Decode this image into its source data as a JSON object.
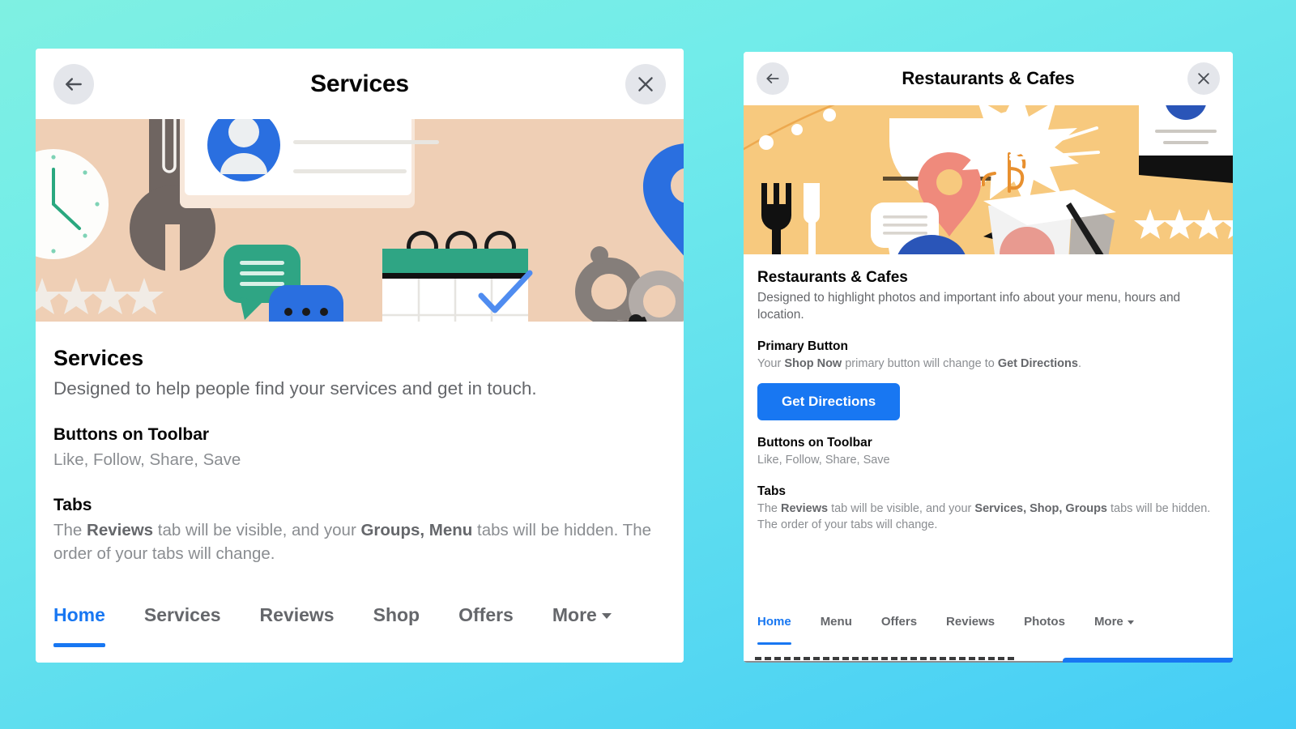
{
  "background": {
    "from": "#7ff0e2",
    "to": "#45cdf6"
  },
  "theme": {
    "accent": "#1877f2",
    "text_primary": "#050505",
    "text_secondary": "#65676b",
    "text_muted": "#8a8d91"
  },
  "cards": [
    {
      "id": "services",
      "header": {
        "title": "Services",
        "back_icon": "back-arrow-icon",
        "close_icon": "close-icon"
      },
      "banner": {
        "icon": "services-illustration",
        "background": "#efcfb5"
      },
      "title": "Services",
      "subtitle": "Designed to help people find your services and get in touch.",
      "sections": [
        {
          "heading": "Buttons on Toolbar",
          "text": "Like, Follow, Share, Save"
        },
        {
          "heading": "Tabs",
          "text_parts": [
            {
              "t": "The ",
              "b": false
            },
            {
              "t": "Reviews",
              "b": true
            },
            {
              "t": " tab will be visible, and your ",
              "b": false
            },
            {
              "t": "Groups, Menu",
              "b": true
            },
            {
              "t": " tabs will be hidden. The order of your tabs will change.",
              "b": false
            }
          ]
        }
      ],
      "tabs": [
        {
          "label": "Home",
          "active": true,
          "caret": false
        },
        {
          "label": "Services",
          "active": false,
          "caret": false
        },
        {
          "label": "Reviews",
          "active": false,
          "caret": false
        },
        {
          "label": "Shop",
          "active": false,
          "caret": false
        },
        {
          "label": "Offers",
          "active": false,
          "caret": false
        },
        {
          "label": "More",
          "active": false,
          "caret": true
        }
      ]
    },
    {
      "id": "restaurants",
      "header": {
        "title": "Restaurants & Cafes",
        "back_icon": "back-arrow-icon",
        "close_icon": "close-icon"
      },
      "banner": {
        "icon": "restaurants-illustration",
        "background": "#f7c97e"
      },
      "title": "Restaurants & Cafes",
      "subtitle": "Designed to highlight photos and important info about your menu, hours and location.",
      "primary_button_section": {
        "heading": "Primary Button",
        "text_parts": [
          {
            "t": "Your ",
            "b": false
          },
          {
            "t": "Shop Now",
            "b": true
          },
          {
            "t": " primary button will change to ",
            "b": false
          },
          {
            "t": "Get Directions",
            "b": true
          },
          {
            "t": ".",
            "b": false
          }
        ],
        "button_label": "Get Directions"
      },
      "sections": [
        {
          "heading": "Buttons on Toolbar",
          "text": "Like, Follow, Share, Save"
        },
        {
          "heading": "Tabs",
          "text_parts": [
            {
              "t": "The ",
              "b": false
            },
            {
              "t": "Reviews",
              "b": true
            },
            {
              "t": " tab will be visible, and your ",
              "b": false
            },
            {
              "t": "Services, Shop, Groups",
              "b": true
            },
            {
              "t": " tabs will be hidden. The order of your tabs will change.",
              "b": false
            }
          ]
        }
      ],
      "tabs": [
        {
          "label": "Home",
          "active": true,
          "caret": false
        },
        {
          "label": "Menu",
          "active": false,
          "caret": false
        },
        {
          "label": "Offers",
          "active": false,
          "caret": false
        },
        {
          "label": "Reviews",
          "active": false,
          "caret": false
        },
        {
          "label": "Photos",
          "active": false,
          "caret": false
        },
        {
          "label": "More",
          "active": false,
          "caret": true
        }
      ]
    }
  ]
}
